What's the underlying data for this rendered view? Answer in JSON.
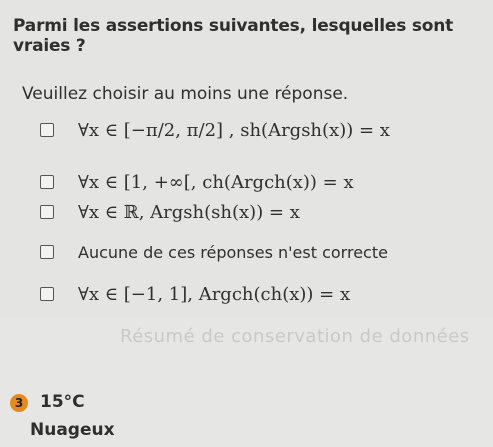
{
  "question": "Parmi les assertions suivantes, lesquelles sont vraies ?",
  "instruction": "Veuillez choisir au moins une réponse.",
  "options": [
    {
      "label": "∀x ∈ [−π/2, π/2] , sh(Argsh(x)) = x"
    },
    {
      "label": "∀x ∈ [1, +∞[, ch(Argch(x)) = x"
    },
    {
      "label": "∀x ∈ ℝ, Argsh(sh(x)) = x"
    },
    {
      "label": "Aucune de ces réponses n'est correcte"
    },
    {
      "label": "∀x ∈ [−1, 1], Argch(ch(x)) = x"
    }
  ],
  "footer_faded": "Résumé de conservation de données",
  "weather": {
    "badge": "3",
    "temperature": "15°C",
    "condition": "Nuageux"
  },
  "colors": {
    "background": "#e4e4e2",
    "text": "#2f2f2f",
    "badge": "#e78a1e"
  }
}
